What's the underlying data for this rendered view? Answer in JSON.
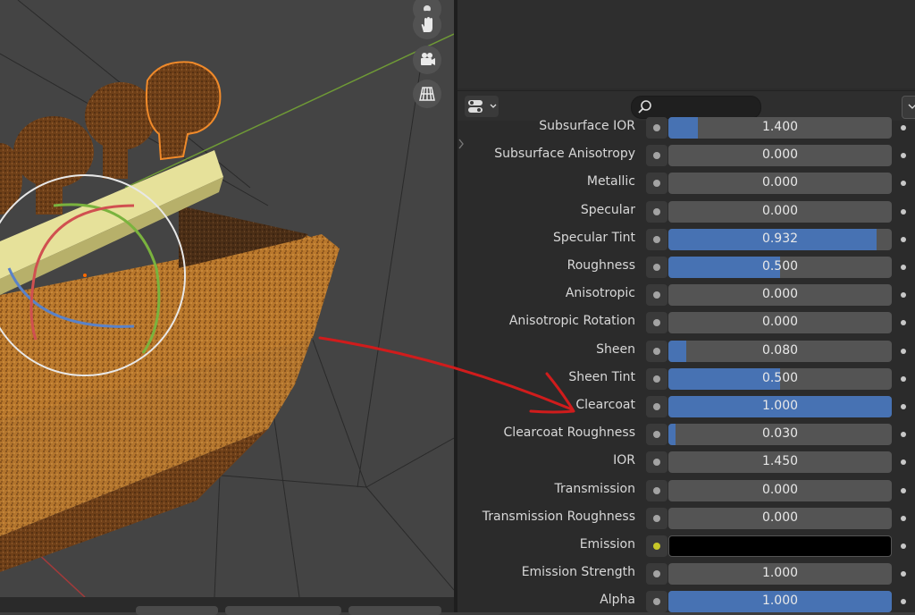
{
  "search": {
    "placeholder": ""
  },
  "properties": [
    {
      "label": "Subsurface IOR",
      "value": "1.400",
      "fill": 0.13
    },
    {
      "label": "Subsurface Anisotropy",
      "value": "0.000",
      "fill": 0
    },
    {
      "label": "Metallic",
      "value": "0.000",
      "fill": 0
    },
    {
      "label": "Specular",
      "value": "0.000",
      "fill": 0
    },
    {
      "label": "Specular Tint",
      "value": "0.932",
      "fill": 0.932
    },
    {
      "label": "Roughness",
      "value": "0.500",
      "fill": 0.5
    },
    {
      "label": "Anisotropic",
      "value": "0.000",
      "fill": 0
    },
    {
      "label": "Anisotropic Rotation",
      "value": "0.000",
      "fill": 0
    },
    {
      "label": "Sheen",
      "value": "0.080",
      "fill": 0.08
    },
    {
      "label": "Sheen Tint",
      "value": "0.500",
      "fill": 0.5
    },
    {
      "label": "Clearcoat",
      "value": "1.000",
      "fill": 1.0
    },
    {
      "label": "Clearcoat Roughness",
      "value": "0.030",
      "fill": 0.03
    },
    {
      "label": "IOR",
      "value": "1.450",
      "fill": 0
    },
    {
      "label": "Transmission",
      "value": "0.000",
      "fill": 0
    },
    {
      "label": "Transmission Roughness",
      "value": "0.000",
      "fill": 0
    },
    {
      "label": "Emission",
      "value": "",
      "fill": 0,
      "color": "#000000",
      "socket": "yellow"
    },
    {
      "label": "Emission Strength",
      "value": "1.000",
      "fill": 0
    },
    {
      "label": "Alpha",
      "value": "1.000",
      "fill": 1.0
    }
  ],
  "colors": {
    "slider_fill": "#4772b3",
    "slider_bg": "#545454",
    "emission_socket": "#c7c728",
    "annotation_arrow": "#d01c1c",
    "selection_outline": "#f08a2a"
  },
  "viewport_tools": [
    "hand-pan-icon",
    "camera-icon",
    "grid-ortho-icon"
  ],
  "annotation": {
    "type": "red-arrow",
    "points_to": "Clearcoat"
  }
}
